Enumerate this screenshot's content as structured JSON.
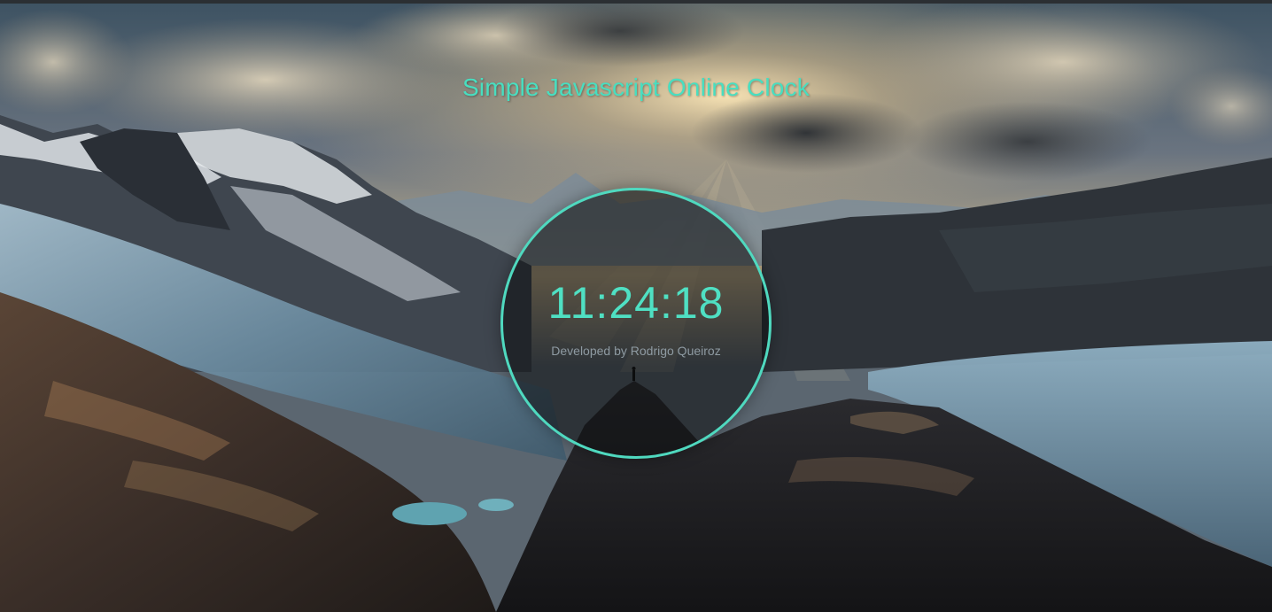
{
  "page": {
    "title": "Simple Javascript Online Clock"
  },
  "clock": {
    "time": "11:24:18",
    "credit": "Developed by Rodrigo Queiroz"
  },
  "colors": {
    "accent": "#4fe0c3",
    "title": "#48dec0",
    "credit": "#8e9aa2",
    "circle_border": "#4fd9bf"
  },
  "background": {
    "description_icon": "mountain-landscape-background"
  }
}
